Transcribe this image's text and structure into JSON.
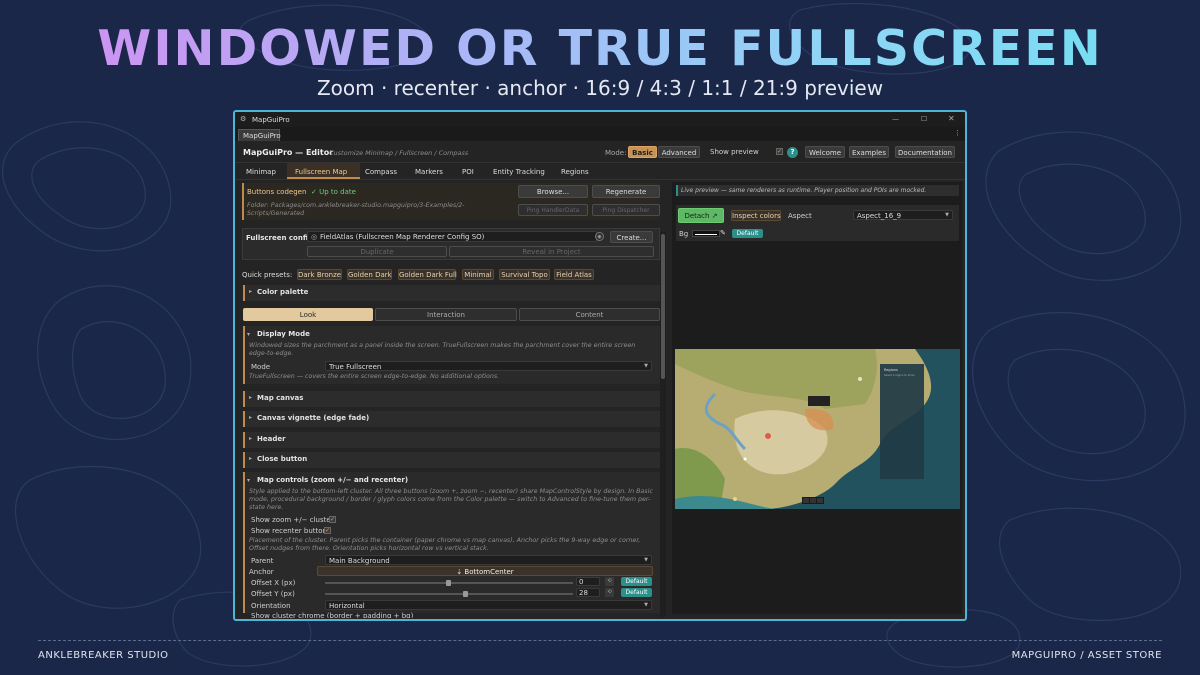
{
  "hero": {
    "title": "WINDOWED OR TRUE FULLSCREEN",
    "subtitle": "Zoom · recenter · anchor · 16:9 / 4:3 / 1:1 / 21:9 preview"
  },
  "footer": {
    "left": "ANKLEBREAKER  STUDIO",
    "right": "MAPGUIPRO  /  ASSET STORE"
  },
  "window": {
    "title": "MapGuiPro",
    "tab": "MapGuiPro",
    "menu_glyph": "⋮"
  },
  "editor": {
    "title": "MapGuiPro — Editor",
    "subtitle": "Customize Minimap / Fullscreen / Compass",
    "mode_label": "Mode:",
    "mode_basic": "Basic",
    "mode_advanced": "Advanced",
    "show_preview": "Show preview",
    "help": "?",
    "welcome": "Welcome",
    "examples": "Examples",
    "documentation": "Documentation"
  },
  "tabs": [
    "Minimap",
    "Fullscreen Map",
    "Compass",
    "Markers",
    "POI",
    "Entity Tracking",
    "Regions"
  ],
  "codegen": {
    "label": "Buttons codegen",
    "status": "✓ Up to date",
    "folder": "Folder: Packages/com.anklebreaker-studio.mapguipro/3-Examples/2-Scripts/Generated",
    "browse": "Browse...",
    "regenerate": "Regenerate",
    "ping_handler": "Ping HandlerData",
    "ping_dispatcher": "Ping Dispatcher"
  },
  "config": {
    "label": "Fullscreen config",
    "value": "FieldAtlas (Fullscreen Map Renderer Config SO)",
    "create": "Create...",
    "duplicate": "Duplicate",
    "reveal": "Reveal in Project"
  },
  "presets": {
    "label": "Quick presets:",
    "items": [
      "Dark Bronze",
      "Golden Dark",
      "Golden Dark Full",
      "Minimal",
      "Survival Topo",
      "Field Atlas"
    ]
  },
  "sections": {
    "color_palette": "Color palette",
    "display_mode": "Display Mode",
    "map_canvas": "Map canvas",
    "canvas_vignette": "Canvas vignette (edge fade)",
    "header": "Header",
    "close_button": "Close button",
    "map_controls": "Map controls (zoom +/− and recenter)"
  },
  "subtabs": [
    "Look",
    "Interaction",
    "Content"
  ],
  "display": {
    "desc": "Windowed sizes the parchment as a panel inside the screen. TrueFullscreen makes the parchment cover the entire screen edge-to-edge.",
    "mode_label": "Mode",
    "mode_value": "True Fullscreen",
    "hint": "TrueFullscreen — covers the entire screen edge-to-edge. No additional options."
  },
  "controls": {
    "desc": "Style applied to the bottom-left cluster. All three buttons (zoom +, zoom −, recenter) share MapControlStyle by design. In Basic mode, procedural background / border / glyph colors come from the Color palette — switch to Advanced to fine-tune them per-state here.",
    "show_zoom": "Show zoom +/− cluster",
    "show_recenter": "Show recenter button",
    "placement_desc": "Placement of the cluster. Parent picks the container (paper chrome vs map canvas), Anchor picks the 9-way edge or corner, Offset nudges from there. Orientation picks horizontal row vs vertical stack.",
    "parent_label": "Parent",
    "parent_value": "Main Background",
    "anchor_label": "Anchor",
    "anchor_value": "⇣ BottomCenter",
    "offx_label": "Offset X (px)",
    "offx_value": "0",
    "offy_label": "Offset Y (px)",
    "offy_value": "28",
    "default": "Default",
    "orient_label": "Orientation",
    "orient_value": "Horizontal",
    "chrome_label": "Show cluster chrome (border + padding + bg)"
  },
  "preview": {
    "note": "Live preview — same renderers as runtime. Player position and POIs are mocked.",
    "detach": "Detach ↗",
    "inspect": "Inspect colors",
    "aspect_label": "Aspect",
    "aspect_value": "Aspect_16_9",
    "bg_label": "Bg",
    "default": "Default",
    "panel_title": "Regions",
    "panel_sub": "Select a region to focus"
  },
  "colors": {
    "accent": "#c08a4e",
    "teal": "#2b8f8a",
    "green": "#5fb865",
    "border": "#4bb6d8"
  }
}
